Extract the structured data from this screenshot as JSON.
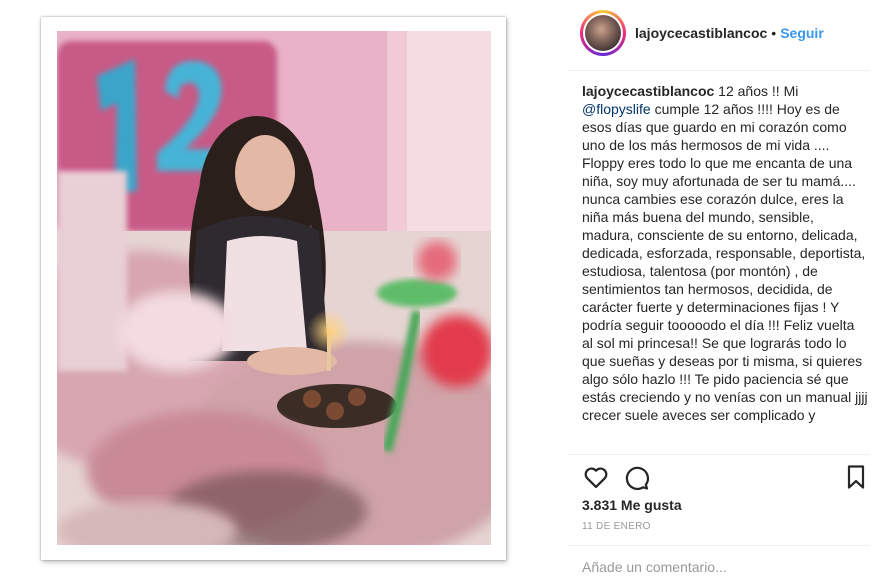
{
  "post": {
    "username": "lajoycecastiblancoc",
    "separator": "•",
    "follow_label": "Seguir",
    "caption": {
      "username": "lajoycecastiblancoc",
      "before_mention": " 12 años !! Mi ",
      "mention": "@flopyslife",
      "after_mention": " cumple 12 años !!!! Hoy es de esos días que guardo en mi corazón como uno de los más hermosos de mi vida .... Floppy eres todo lo que me encanta de una niña, soy muy afortunada de ser tu mamá.... nunca cambies ese corazón dulce, eres la niña más buena del mundo, sensible, madura, consciente de su entorno, delicada, dedicada, esforzada, responsable, deportista, estudiosa, talentosa (por montón) , de sentimientos tan hermosos, decidida, de carácter fuerte y determinaciones fijas ! Y podría seguir tooooodo el día !!! Feliz vuelta al sol mi princesa!! Se que lograrás todo lo que sueñas y deseas por ti misma, si quieres algo sólo hazlo !!! Te pido paciencia sé que estás creciendo y no venías con un manual jjjj crecer suele aveces ser complicado y"
    },
    "likes": "3.831 Me gusta",
    "date": "11 DE ENERO",
    "comment_placeholder": "Añade un comentario...",
    "icons": {
      "like": "heart-outline-icon",
      "comment": "speech-bubble-icon",
      "save": "bookmark-icon"
    },
    "colors": {
      "accent": "#3897f0",
      "mention": "#003569",
      "balloon": "#3aa5c9",
      "wall": "#ecb6c9"
    }
  }
}
